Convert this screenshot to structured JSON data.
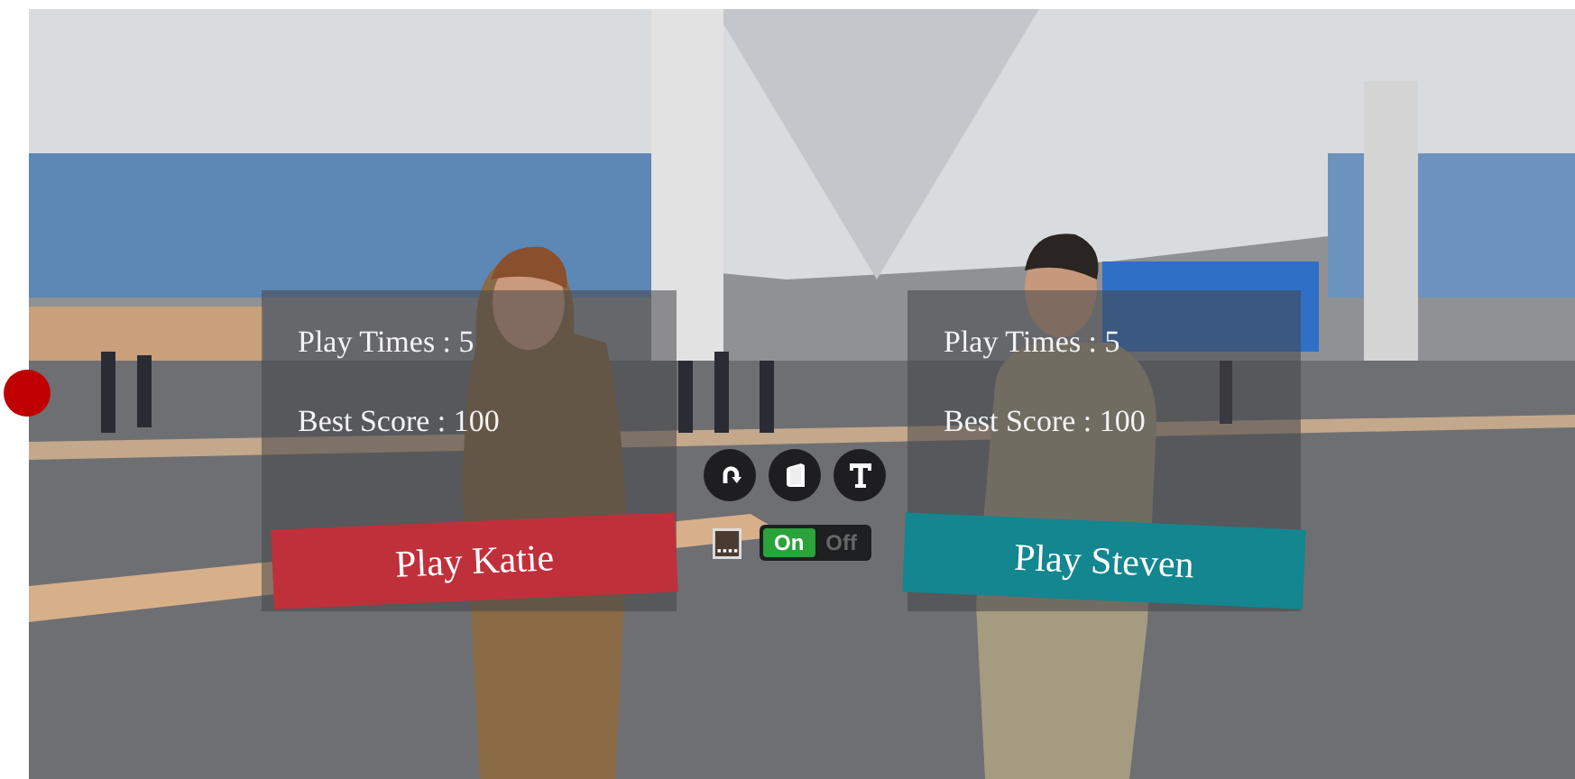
{
  "panels": [
    {
      "play_times": "Play Times : 5",
      "best_score": "Best Score : 100",
      "button": "Play Katie",
      "color": "#c0303a"
    },
    {
      "play_times": "Play Times : 5",
      "best_score": "Best Score : 100",
      "button": "Play Steven",
      "color": "#138690"
    }
  ],
  "round_buttons": [
    {
      "kind": "rotate"
    },
    {
      "kind": "book"
    },
    {
      "kind": "text"
    }
  ],
  "toggle": {
    "on_label": "On",
    "off_label": "Off",
    "on": true
  }
}
